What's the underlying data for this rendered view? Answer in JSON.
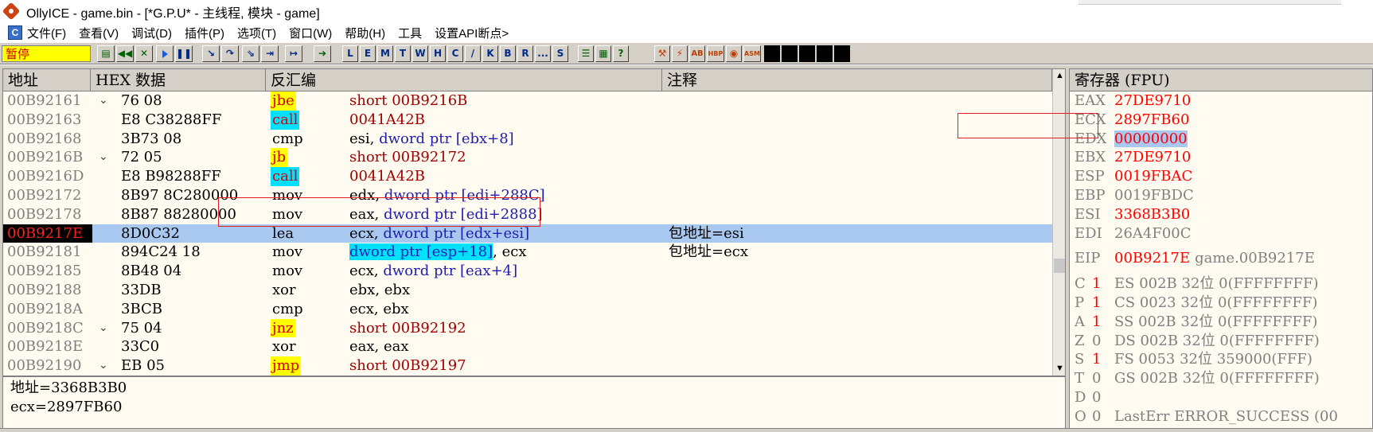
{
  "window": {
    "title": "OllyICE - game.bin - [*G.P.U* -  主线程, 模块 - game]",
    "mdi_icon": "C"
  },
  "menu": [
    "文件(F)",
    "查看(V)",
    "调试(D)",
    "插件(P)",
    "选项(T)",
    "窗口(W)",
    "帮助(H)",
    "工具",
    "设置API断点>"
  ],
  "toolbar": {
    "status": "暂停",
    "letter_buttons": [
      "L",
      "E",
      "M",
      "T",
      "W",
      "H",
      "C",
      "/",
      "K",
      "B",
      "R",
      "...",
      "S"
    ],
    "plugin_buttons": [
      "AB",
      "HBP",
      "ASM"
    ]
  },
  "disasm": {
    "headers": {
      "address": "地址",
      "hex": "HEX 数据",
      "disasm": "反汇编",
      "comment": "注释"
    },
    "rows": [
      {
        "addr": "00B92161",
        "jmark": "⌄",
        "hex": "76 08",
        "mnem": "jbe",
        "type": "jcc",
        "ops": [
          {
            "t": "short 00B9216B",
            "c": "tgt"
          }
        ],
        "comment": ""
      },
      {
        "addr": "00B92163",
        "jmark": "",
        "hex": "E8 C38288FF",
        "mnem": "call",
        "type": "call",
        "ops": [
          {
            "t": "0041A42B",
            "c": "tgt"
          }
        ],
        "comment": ""
      },
      {
        "addr": "00B92168",
        "jmark": "",
        "hex": "3B73 08",
        "mnem": "cmp",
        "type": "",
        "ops": [
          {
            "t": "esi, ",
            "c": ""
          },
          {
            "t": "dword ptr [ebx+8]",
            "c": "kw"
          }
        ],
        "comment": ""
      },
      {
        "addr": "00B9216B",
        "jmark": "⌄",
        "hex": "72 05",
        "mnem": "jb",
        "type": "jcc",
        "ops": [
          {
            "t": "short 00B92172",
            "c": "tgt"
          }
        ],
        "comment": ""
      },
      {
        "addr": "00B9216D",
        "jmark": "",
        "hex": "E8 B98288FF",
        "mnem": "call",
        "type": "call",
        "ops": [
          {
            "t": "0041A42B",
            "c": "tgt"
          }
        ],
        "comment": ""
      },
      {
        "addr": "00B92172",
        "jmark": "",
        "hex": "8B97 8C280000",
        "mnem": "mov",
        "type": "",
        "ops": [
          {
            "t": "edx, ",
            "c": ""
          },
          {
            "t": "dword ptr [edi+288C]",
            "c": "kw"
          }
        ],
        "comment": ""
      },
      {
        "addr": "00B92178",
        "jmark": "",
        "hex": "8B87 88280000",
        "mnem": "mov",
        "type": "",
        "ops": [
          {
            "t": "eax, ",
            "c": ""
          },
          {
            "t": "dword ptr [edi+2888]",
            "c": "kw"
          }
        ],
        "comment": ""
      },
      {
        "addr": "00B9217E",
        "jmark": "",
        "hex": "8D0C32",
        "mnem": "lea",
        "type": "",
        "ops": [
          {
            "t": "ecx, ",
            "c": ""
          },
          {
            "t": "dword ptr [edx+esi]",
            "c": "kw"
          }
        ],
        "comment": "包地址=esi",
        "selected": true
      },
      {
        "addr": "00B92181",
        "jmark": "",
        "hex": "894C24 18",
        "mnem": "mov",
        "type": "",
        "ops": [
          {
            "t": "dword ptr [esp+18]",
            "c": "hl"
          },
          {
            "t": ", ecx",
            "c": ""
          }
        ],
        "comment": "包地址=ecx"
      },
      {
        "addr": "00B92185",
        "jmark": "",
        "hex": "8B48 04",
        "mnem": "mov",
        "type": "",
        "ops": [
          {
            "t": "ecx, ",
            "c": ""
          },
          {
            "t": "dword ptr [eax+4]",
            "c": "kw"
          }
        ],
        "comment": ""
      },
      {
        "addr": "00B92188",
        "jmark": "",
        "hex": "33DB",
        "mnem": "xor",
        "type": "",
        "ops": [
          {
            "t": "ebx, ebx",
            "c": ""
          }
        ],
        "comment": ""
      },
      {
        "addr": "00B9218A",
        "jmark": "",
        "hex": "3BCB",
        "mnem": "cmp",
        "type": "",
        "ops": [
          {
            "t": "ecx, ebx",
            "c": ""
          }
        ],
        "comment": ""
      },
      {
        "addr": "00B9218C",
        "jmark": "⌄",
        "hex": "75 04",
        "mnem": "jnz",
        "type": "jcc",
        "ops": [
          {
            "t": "short 00B92192",
            "c": "tgt"
          }
        ],
        "comment": ""
      },
      {
        "addr": "00B9218E",
        "jmark": "",
        "hex": "33C0",
        "mnem": "xor",
        "type": "",
        "ops": [
          {
            "t": "eax, eax",
            "c": ""
          }
        ],
        "comment": ""
      },
      {
        "addr": "00B92190",
        "jmark": "⌄",
        "hex": "EB 05",
        "mnem": "jmp",
        "type": "jcc",
        "ops": [
          {
            "t": "short 00B92197",
            "c": "tgt"
          }
        ],
        "comment": ""
      }
    ]
  },
  "info": {
    "line1": "地址=3368B3B0",
    "line2": "ecx=2897FB60"
  },
  "registers": {
    "header": "寄存器 (FPU)",
    "general": [
      {
        "name": "EAX",
        "value": "27DE9710",
        "changed": true
      },
      {
        "name": "ECX",
        "value": "2897FB60",
        "changed": true
      },
      {
        "name": "EDX",
        "value": "00000000",
        "changed": true,
        "selected": true
      },
      {
        "name": "EBX",
        "value": "27DE9710",
        "changed": true
      },
      {
        "name": "ESP",
        "value": "0019FBAC",
        "changed": true
      },
      {
        "name": "EBP",
        "value": "0019FBDC",
        "changed": false
      },
      {
        "name": "ESI",
        "value": "3368B3B0",
        "changed": true
      },
      {
        "name": "EDI",
        "value": "26A4F00C",
        "changed": false
      }
    ],
    "eip": {
      "name": "EIP",
      "value": "00B9217E",
      "extra": "game.00B9217E"
    },
    "flags": [
      {
        "f": "C",
        "v": "1",
        "changed": true,
        "seg": "ES 002B 32位 0(FFFFFFFF)"
      },
      {
        "f": "P",
        "v": "1",
        "changed": true,
        "seg": "CS 0023 32位 0(FFFFFFFF)"
      },
      {
        "f": "A",
        "v": "1",
        "changed": true,
        "seg": "SS 002B 32位 0(FFFFFFFF)"
      },
      {
        "f": "Z",
        "v": "0",
        "changed": false,
        "seg": "DS 002B 32位 0(FFFFFFFF)"
      },
      {
        "f": "S",
        "v": "1",
        "changed": true,
        "seg": "FS 0053 32位 359000(FFF)"
      },
      {
        "f": "T",
        "v": "0",
        "changed": false,
        "seg": "GS 002B 32位 0(FFFFFFFF)"
      },
      {
        "f": "D",
        "v": "0",
        "changed": false,
        "seg": ""
      },
      {
        "f": "O",
        "v": "0",
        "changed": false,
        "seg": "LastErr ERROR_SUCCESS (00"
      }
    ]
  }
}
